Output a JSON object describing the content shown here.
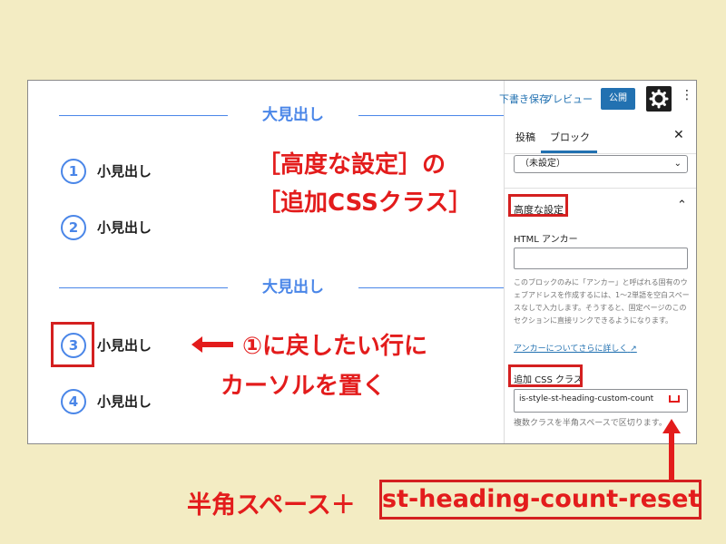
{
  "canvas": {
    "heading_large_1": "大見出し",
    "heading_large_2": "大見出し",
    "items": [
      {
        "num": "1",
        "label": "小見出し"
      },
      {
        "num": "2",
        "label": "小見出し"
      },
      {
        "num": "3",
        "label": "小見出し"
      },
      {
        "num": "4",
        "label": "小見出し"
      }
    ]
  },
  "annotations": {
    "advanced_title_line1": "［高度な設定］の",
    "advanced_title_line2": "［追加CSSクラス］",
    "instruction_line1": "①に戻したい行に",
    "instruction_line2": "カーソルを置く",
    "bottom_text": "半角スペース＋",
    "bottom_code": "st-heading-count-reset"
  },
  "sidebar": {
    "topbar": {
      "save": "下書き保存",
      "preview": "プレビュー",
      "publish": "公開",
      "gear_icon": "gear-icon",
      "more_icon": "more-vertical-icon"
    },
    "tabs": [
      "投稿",
      "ブロック"
    ],
    "close_icon": "close-icon",
    "select_value": "（未設定）",
    "advanced_title": "高度な設定",
    "html_anchor_label": "HTML アンカー",
    "html_anchor_value": "",
    "help_text": "このブロックのみに「アンカー」と呼ばれる固有のウェブアドレスを作成するには、1〜2単語を空白スペースなしで入力します。そうすると、固定ページのこのセクションに直接リンクできるようになります。",
    "help_link": "アンカーについてさらに詳しく",
    "css_label": "追加 CSS クラス",
    "css_value": "is-style-st-heading-custom-count",
    "css_note": "複数クラスを半角スペースで区切ります。"
  },
  "colors": {
    "background": "#f3ecc3",
    "accent_blue": "#4a86e8",
    "annotation_red": "#e31c1c",
    "wp_blue": "#2271b1"
  }
}
